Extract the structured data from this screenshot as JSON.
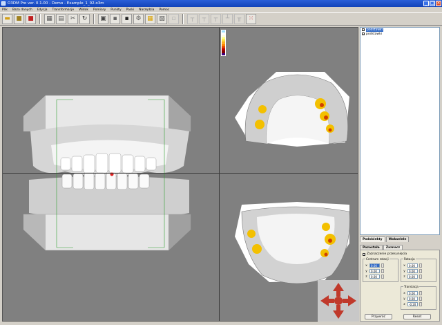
{
  "window": {
    "title": "O3DM Pro ver. 0.1.00 - Demo - Example_1_02.o3m"
  },
  "window_controls": {
    "minimize": "_",
    "maximize": "□",
    "close": "×"
  },
  "menu": [
    "Plik",
    "Baza danych",
    "Edycja",
    "Transformacje",
    "Widok",
    "Pomiary",
    "Punkty",
    "Paski",
    "Narzędzia",
    "Pomoc"
  ],
  "toolbar": {
    "icons": [
      "open-folder-icon",
      "save-icon",
      "save-red-icon",
      "layout-grid-icon",
      "measure-icon",
      "scissors-icon",
      "rotate-icon",
      "cube-frame-icon",
      "disk-icon",
      "disk-dark-icon",
      "settings-icon",
      "grid-yellow-icon",
      "select-icon",
      "tool-icon",
      "pin1-icon",
      "pin2-icon",
      "pin3-icon",
      "pin4-icon",
      "pin5-icon",
      "dice-icon"
    ]
  },
  "colors": {
    "accent": "#316ac5",
    "title": "#1e4fc7",
    "nav_arrow": "#c0392b"
  },
  "color_scale": [
    "#a0e0ff",
    "#ffffff",
    "#ffffe0",
    "#ffff80",
    "#ffe040",
    "#ffb020",
    "#ff8000",
    "#e04000",
    "#c00000",
    "#800000",
    "#400080"
  ],
  "tree": [
    {
      "label": "podstawki",
      "checked": true,
      "selected": true
    },
    {
      "label": "podstawki",
      "checked": true,
      "selected": false
    }
  ],
  "tabs_main": [
    {
      "label": "Podobiekty",
      "active": true
    },
    {
      "label": "Wokselele",
      "active": false
    }
  ],
  "tabs_sub": [
    {
      "label": "Pozostałe",
      "active": false
    },
    {
      "label": "Zaznacz",
      "active": true
    }
  ],
  "panel": {
    "checkbox_label": "Zaznaczenie przesunięcia",
    "center_group": "Centrum rotacji",
    "rotation_group": "Rotacja",
    "translation_group": "Translacja",
    "axes": [
      "x",
      "y",
      "z"
    ],
    "center_values": [
      "0.00",
      "0.00",
      "0.00"
    ],
    "rotation_values": [
      "0.00",
      "0.00",
      "0.00"
    ],
    "translation_values": [
      "0.00",
      "0.00",
      "-0.20"
    ],
    "apply_label": "Przywróć",
    "reset_label": "Reset"
  }
}
